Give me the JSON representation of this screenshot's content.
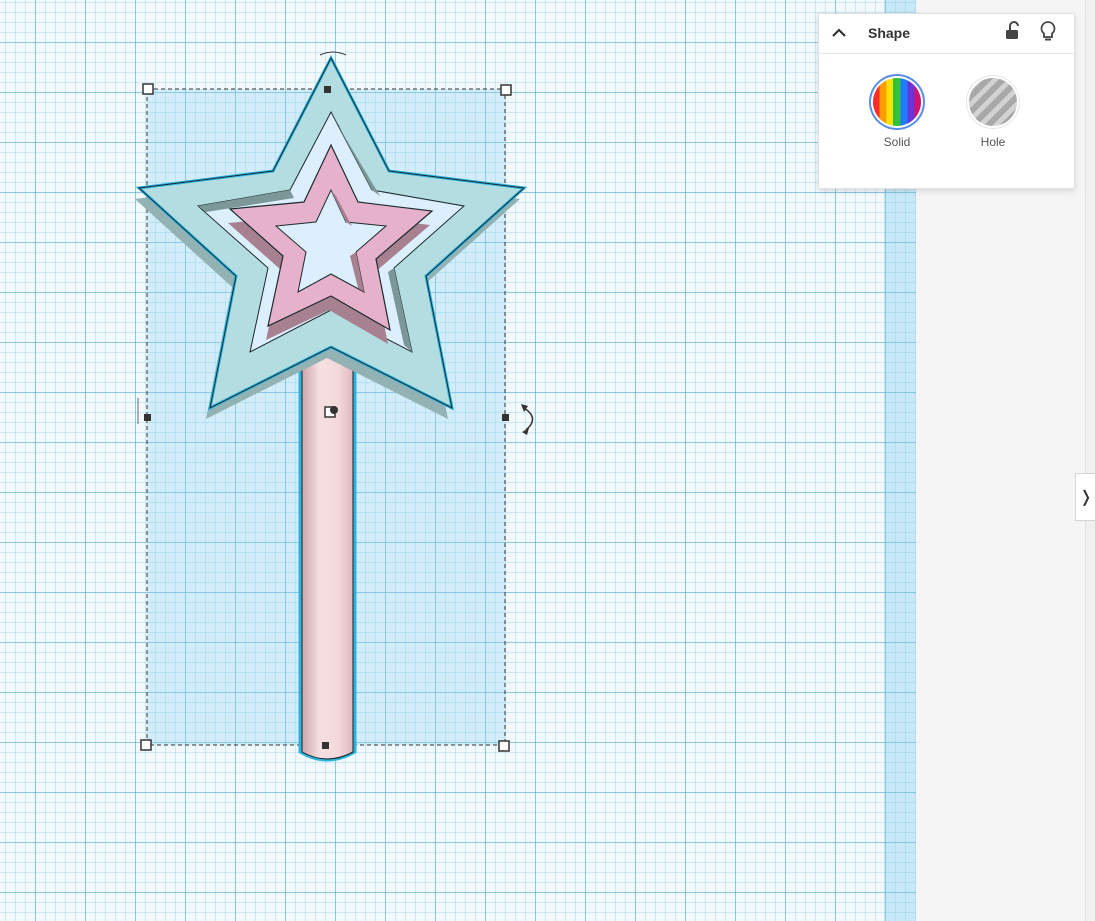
{
  "shape_panel": {
    "title": "Shape",
    "modes": [
      {
        "label": "Solid",
        "selected": true,
        "icon": "rainbow-stripes-icon"
      },
      {
        "label": "Hole",
        "selected": false,
        "icon": "gray-stripes-icon"
      }
    ]
  },
  "icons": {
    "collapse": "chevron-up-icon",
    "lock": "unlock-icon",
    "bulb": "lightbulb-icon",
    "expand": "chevron-right-icon",
    "rotate": "rotate-arrow-icon"
  },
  "colors": {
    "selection": "#2ab4e0",
    "outer_star": "#b3dde0",
    "inner_star": "#e5b1cb",
    "handle": "#f4d9dc",
    "grid": "#7ec4e6"
  }
}
